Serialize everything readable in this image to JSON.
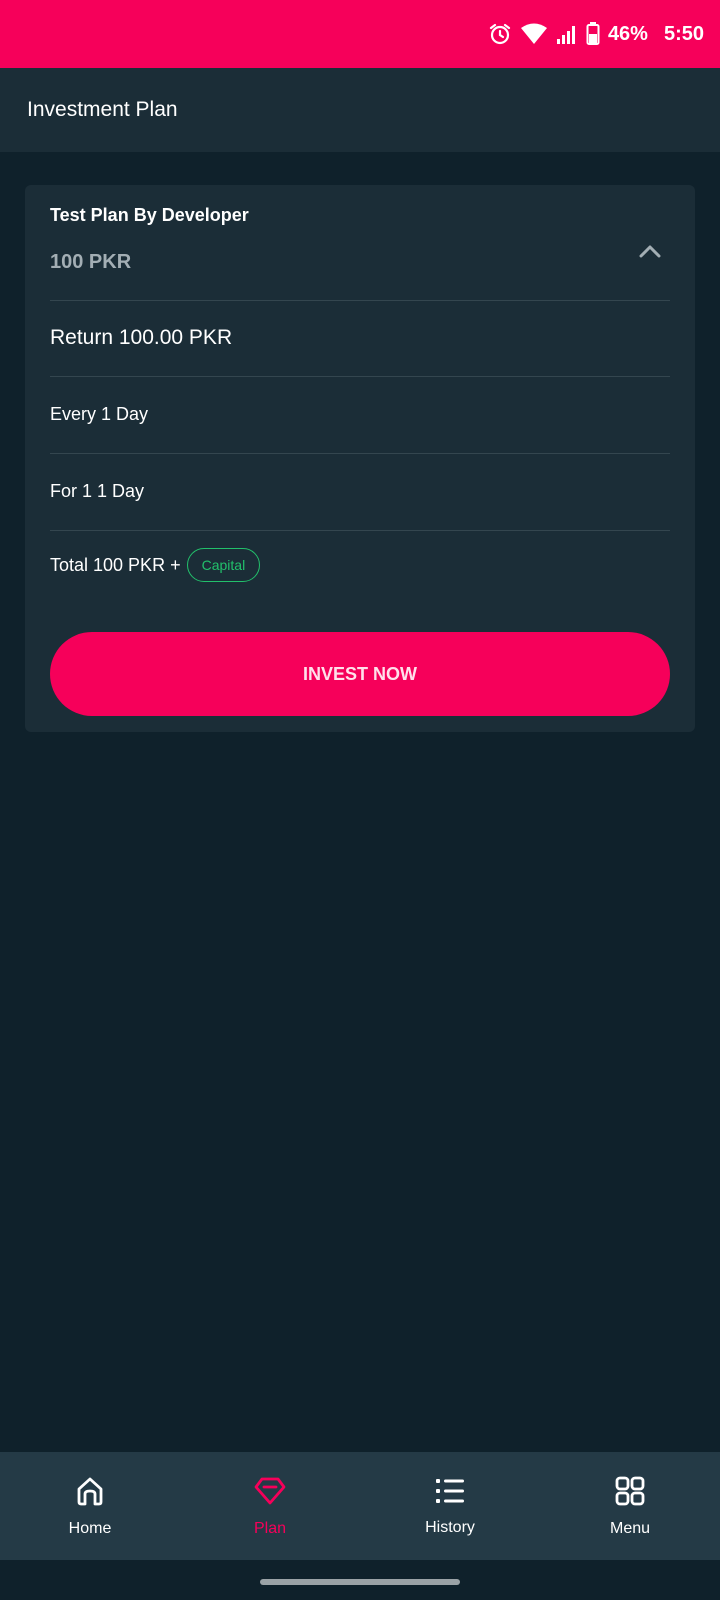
{
  "status_bar": {
    "battery_percent": "46%",
    "time": "5:50",
    "icons": [
      "alarm-icon",
      "wifi-icon",
      "signal-icon",
      "battery-icon"
    ]
  },
  "app_bar": {
    "title": "Investment Plan"
  },
  "plan": {
    "name": "Test Plan By Developer",
    "price": "100 PKR",
    "return_text": "Return 100.00 PKR",
    "every_text": "Every 1 Day",
    "for_text": "For 1 1 Day",
    "total_text": "Total 100 PKR +",
    "capital_badge": "Capital",
    "invest_button": "INVEST NOW",
    "expanded": true
  },
  "bottom_nav": {
    "items": [
      {
        "label": "Home",
        "icon": "home-icon",
        "active": false
      },
      {
        "label": "Plan",
        "icon": "diamond-icon",
        "active": true
      },
      {
        "label": "History",
        "icon": "list-icon",
        "active": false
      },
      {
        "label": "Menu",
        "icon": "grid-icon",
        "active": false
      }
    ]
  },
  "colors": {
    "accent": "#f6005a",
    "background": "#0f212b",
    "surface": "#1b2d37",
    "nav_background": "#243a46",
    "success": "#22c06b",
    "muted_text": "#a3aeb4"
  }
}
